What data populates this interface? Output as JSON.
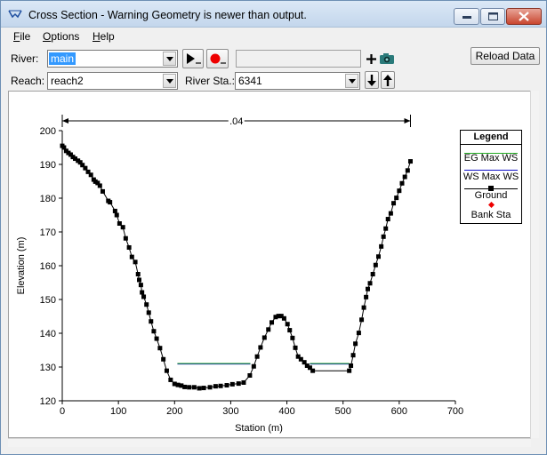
{
  "window": {
    "title": "Cross Section - Warning Geometry is newer than output."
  },
  "menu": [
    {
      "label": "File",
      "accel": "F",
      "rest": "ile"
    },
    {
      "label": "Options",
      "accel": "O",
      "rest": "ptions"
    },
    {
      "label": "Help",
      "accel": "H",
      "rest": "elp"
    }
  ],
  "toolbar": {
    "river_label": "River:",
    "river_value": "main",
    "reach_label": "Reach:",
    "reach_value": "reach2",
    "river_sta_label": "River Sta.:",
    "river_sta_value": "6341",
    "reload_label": "Reload Data",
    "plan_box_value": ""
  },
  "colors": {
    "eg": "#22aa22",
    "ws": "#1010c8",
    "ground": "#000000",
    "bank": "#ee0000"
  },
  "icons": [
    "play-animate-icon",
    "record-icon",
    "add-icon",
    "camera-icon",
    "down-arrow-icon",
    "up-arrow-icon"
  ],
  "chart_data": {
    "type": "line",
    "xlabel": "Station (m)",
    "ylabel": "Elevation (m)",
    "xlim": [
      0,
      700
    ],
    "ylim": [
      120,
      200
    ],
    "xticks": [
      0,
      100,
      200,
      300,
      400,
      500,
      600,
      700
    ],
    "yticks": [
      120,
      130,
      140,
      150,
      160,
      170,
      180,
      190,
      200
    ],
    "manning_label": ".04",
    "manning_span": [
      0,
      620
    ],
    "grid": false,
    "legend": {
      "title": "Legend",
      "placement": "right",
      "entries": [
        "EG Max WS",
        "WS Max WS",
        "Ground",
        "Bank Sta"
      ]
    },
    "water_surface": [
      {
        "x": [
          205,
          335
        ],
        "y": 130.9
      },
      {
        "x": 441,
        "x_end": 511,
        "y": 130.9
      }
    ],
    "ground": {
      "x": [
        0,
        3,
        7,
        11,
        15,
        19,
        23,
        28,
        32,
        36,
        41,
        46,
        51,
        56,
        59,
        63,
        67,
        72,
        82,
        85,
        94,
        97,
        102,
        108,
        113,
        119,
        124,
        130,
        135,
        137,
        140,
        142,
        145,
        150,
        154,
        158,
        163,
        168,
        174,
        180,
        186,
        193,
        200,
        206,
        212,
        218,
        226,
        235,
        244,
        252,
        263,
        273,
        282,
        293,
        303,
        314,
        323,
        334,
        341,
        347,
        353,
        360,
        367,
        373,
        380,
        385,
        390,
        395,
        401,
        405,
        410,
        415,
        420,
        425,
        431,
        436,
        441,
        446,
        511,
        514,
        518,
        522,
        528,
        533,
        537,
        541,
        544,
        548,
        553,
        558,
        563,
        568,
        572,
        576,
        580,
        585,
        590,
        595,
        600,
        605,
        610,
        615,
        620
      ],
      "y": [
        195.5,
        195,
        194,
        193.4,
        192.9,
        192.2,
        191.7,
        191.1,
        190.6,
        189.8,
        188.9,
        187.8,
        186.9,
        185.5,
        184.9,
        184.5,
        183.7,
        182,
        179.2,
        178.8,
        176.2,
        175,
        172.5,
        171.4,
        168.1,
        165.4,
        162.6,
        161.1,
        157.5,
        155.8,
        154.3,
        152.1,
        150.8,
        148.5,
        146.1,
        143.5,
        140.6,
        138.4,
        135.6,
        132.3,
        128.9,
        126.2,
        125,
        124.7,
        124.5,
        124.1,
        124,
        124,
        123.7,
        123.8,
        124,
        124.3,
        124.4,
        124.6,
        124.9,
        125.1,
        125.4,
        127.5,
        130.2,
        133.1,
        135.8,
        138.7,
        141.1,
        143.2,
        144.8,
        145.1,
        145.1,
        144.4,
        142.7,
        140.9,
        138.6,
        135.7,
        133.1,
        132.3,
        131.4,
        130.4,
        129.8,
        128.9,
        128.9,
        130.4,
        133.5,
        136.9,
        140.1,
        144,
        147.6,
        150.7,
        153.1,
        154.8,
        157.5,
        160.2,
        162.7,
        165.7,
        168.6,
        171,
        173.8,
        175.5,
        178.5,
        180.1,
        182.2,
        184.4,
        186.3,
        188.2,
        190.9,
        191.6
      ]
    }
  }
}
